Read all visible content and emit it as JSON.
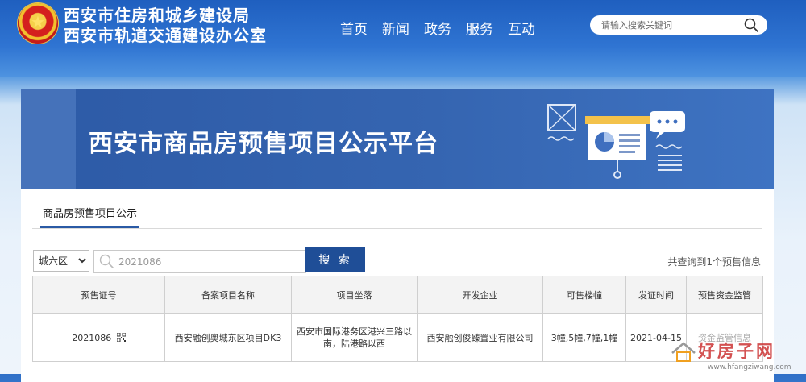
{
  "header": {
    "org_line1": "西安市住房和城乡建设局",
    "org_line2": "西安市轨道交通建设办公室",
    "nav": [
      "首页",
      "新闻",
      "政务",
      "服务",
      "互动"
    ],
    "search_placeholder": "请输入搜索关键词"
  },
  "banner": {
    "title": "西安市商品房预售项目公示平台"
  },
  "panel": {
    "tab_label": "商品房预售项目公示",
    "district_selected": "城六区",
    "keyword_value": "2021086",
    "search_button": "搜 索",
    "result_prefix": "共查询到",
    "result_count": "1",
    "result_suffix": "个预售信息"
  },
  "table": {
    "headers": [
      "预售证号",
      "备案项目名称",
      "项目坐落",
      "开发企业",
      "可售楼幢",
      "发证时间",
      "预售资金监管"
    ],
    "rows": [
      {
        "cert_no": "2021086",
        "project": "西安融创奥城东区项目DK3",
        "location": "西安市国际港务区港兴三路以南，陆港路以西",
        "developer": "西安融创俊臻置业有限公司",
        "buildings": "3幢,5幢,7幢,1幢",
        "issue_date": "2021-04-15",
        "fund": "资金监管信息"
      }
    ]
  },
  "watermark": {
    "text": "好房子网",
    "url": "www.hfangziwang.com"
  },
  "colors": {
    "header_blue": "#2f74d2",
    "banner_blue": "#3565b1",
    "button_blue": "#1f4e97"
  }
}
